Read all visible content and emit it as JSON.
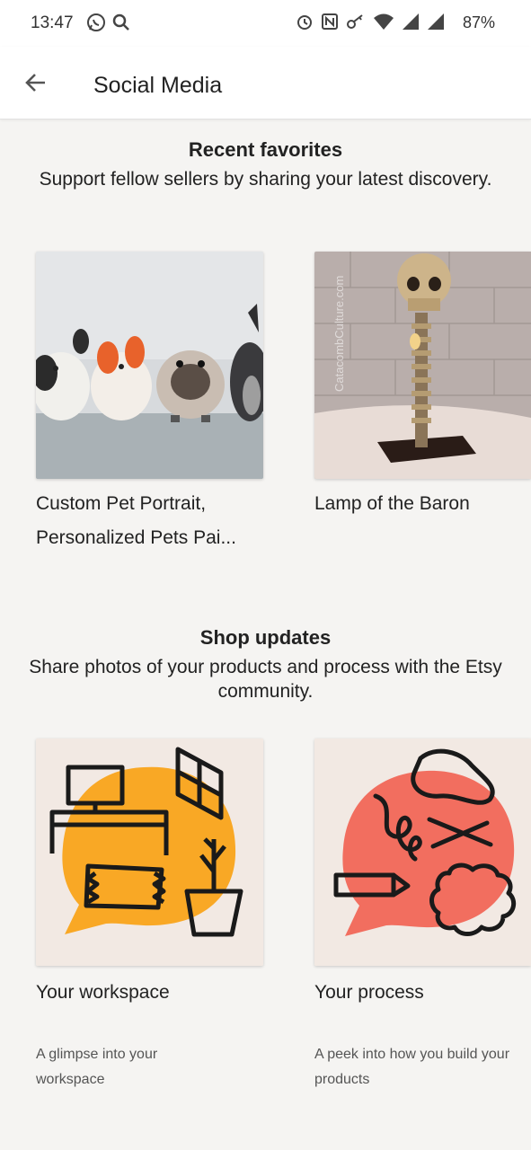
{
  "status_bar": {
    "time": "13:47",
    "battery": "87%",
    "icons": [
      "whatsapp-icon",
      "search-icon",
      "alarm-icon",
      "nfc-icon",
      "key-icon",
      "wifi-icon",
      "signal-icon",
      "signal-icon"
    ]
  },
  "app_bar": {
    "title": "Social Media",
    "back_icon": "arrow-left-icon"
  },
  "recent_favorites": {
    "title": "Recent favorites",
    "subtitle": "Support fellow sellers by sharing your latest discovery.",
    "items": [
      {
        "title_line1": "Custom Pet Portrait,",
        "title_line2": "Personalized Pets Pai..."
      },
      {
        "title_line1": "Lamp of the Baron",
        "watermark": "CatacombCulture.com"
      }
    ]
  },
  "shop_updates": {
    "title": "Shop updates",
    "subtitle": "Share photos of your products and process with the Etsy community.",
    "items": [
      {
        "title": "Your workspace",
        "description": "A glimpse into your workspace",
        "accent": "#f9a825"
      },
      {
        "title": "Your process",
        "description": "A peek into how you build your products",
        "accent": "#f26e5f"
      }
    ]
  },
  "colors": {
    "background": "#f5f4f2",
    "card_bg": "#f2e9e3"
  }
}
